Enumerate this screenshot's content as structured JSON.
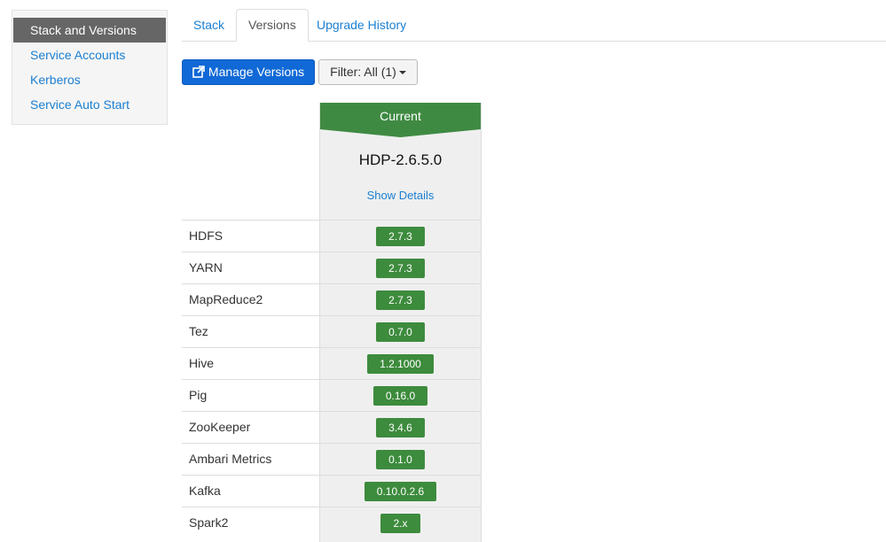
{
  "sidebar": {
    "items": [
      {
        "label": "Stack and Versions"
      },
      {
        "label": "Service Accounts"
      },
      {
        "label": "Kerberos"
      },
      {
        "label": "Service Auto Start"
      }
    ]
  },
  "tabs": [
    {
      "label": "Stack"
    },
    {
      "label": "Versions"
    },
    {
      "label": "Upgrade History"
    }
  ],
  "toolbar": {
    "manage_label": "Manage Versions",
    "filter_label": "Filter: All (1)"
  },
  "version": {
    "banner": "Current",
    "name": "HDP-2.6.5.0",
    "details_link": "Show Details"
  },
  "services": [
    {
      "name": "HDFS",
      "version": "2.7.3"
    },
    {
      "name": "YARN",
      "version": "2.7.3"
    },
    {
      "name": "MapReduce2",
      "version": "2.7.3"
    },
    {
      "name": "Tez",
      "version": "0.7.0"
    },
    {
      "name": "Hive",
      "version": "1.2.1000"
    },
    {
      "name": "Pig",
      "version": "0.16.0"
    },
    {
      "name": "ZooKeeper",
      "version": "3.4.6"
    },
    {
      "name": "Ambari Metrics",
      "version": "0.1.0"
    },
    {
      "name": "Kafka",
      "version": "0.10.0.2.6"
    },
    {
      "name": "Spark2",
      "version": "2.x"
    }
  ],
  "colors": {
    "accent_blue": "#1069d6",
    "link_blue": "#1b7fd1",
    "current_green": "#3f8a43",
    "badge_green": "#3d8b3d",
    "sidebar_active": "#666666"
  }
}
